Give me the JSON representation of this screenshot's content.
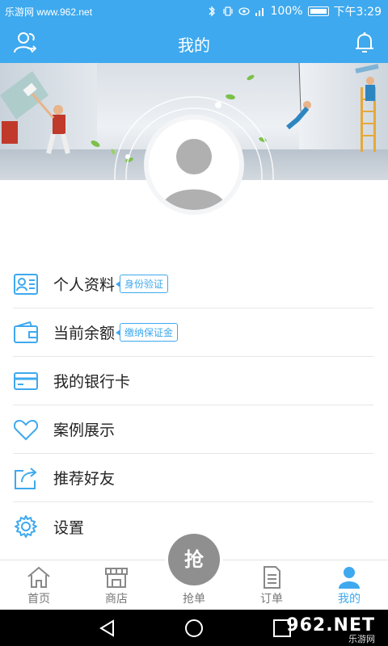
{
  "status_bar": {
    "site_label": "乐游网 www.962.net",
    "battery": "100%",
    "time": "下午3:29"
  },
  "header": {
    "title": "我的"
  },
  "menu": {
    "items": [
      {
        "label": "个人资料",
        "tag": "身份验证",
        "icon": "id-card-icon"
      },
      {
        "label": "当前余额",
        "tag": "缴纳保证金",
        "icon": "wallet-icon"
      },
      {
        "label": "我的银行卡",
        "tag": "",
        "icon": "bank-card-icon"
      },
      {
        "label": "案例展示",
        "tag": "",
        "icon": "heart-icon"
      },
      {
        "label": "推荐好友",
        "tag": "",
        "icon": "share-icon"
      },
      {
        "label": "设置",
        "tag": "",
        "icon": "gear-icon"
      }
    ]
  },
  "bottom_nav": {
    "items": [
      {
        "label": "首页",
        "icon": "home-icon"
      },
      {
        "label": "商店",
        "icon": "store-icon"
      },
      {
        "label": "抢单",
        "icon": "grab-order-icon",
        "button_text": "抢"
      },
      {
        "label": "订单",
        "icon": "order-icon"
      },
      {
        "label": "我的",
        "icon": "user-icon",
        "active": true
      }
    ]
  },
  "watermark": {
    "main": "962.NET",
    "sub": "乐游网"
  },
  "colors": {
    "primary": "#3ea9ee",
    "text": "#222222",
    "inactive": "#777777"
  }
}
